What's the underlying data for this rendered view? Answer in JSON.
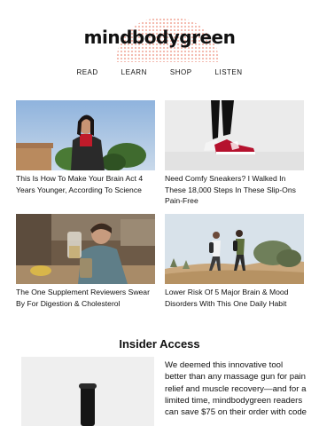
{
  "brand": {
    "logo_text": "mindbodygreen",
    "accent_color": "#f3b8ad"
  },
  "nav": {
    "items": [
      "READ",
      "LEARN",
      "SHOP",
      "LISTEN"
    ]
  },
  "articles": [
    {
      "title": "This Is How To Make Your Brain Act 4 Years Younger, According To Science"
    },
    {
      "title": "Need Comfy Sneakers? I Walked In These 18,000 Steps In These Slip-Ons Pain-Free"
    },
    {
      "title": "The One Supplement Reviewers Swear By For Digestion & Cholesterol"
    },
    {
      "title": "Lower Risk Of 5 Major Brain & Mood Disorders With This One Daily Habit"
    }
  ],
  "insider": {
    "heading": "Insider Access",
    "body": "We deemed this innovative tool better than any massage gun for pain relief and muscle recovery—and for a limited time, mindbodygreen readers can save $75 on their order with code"
  }
}
